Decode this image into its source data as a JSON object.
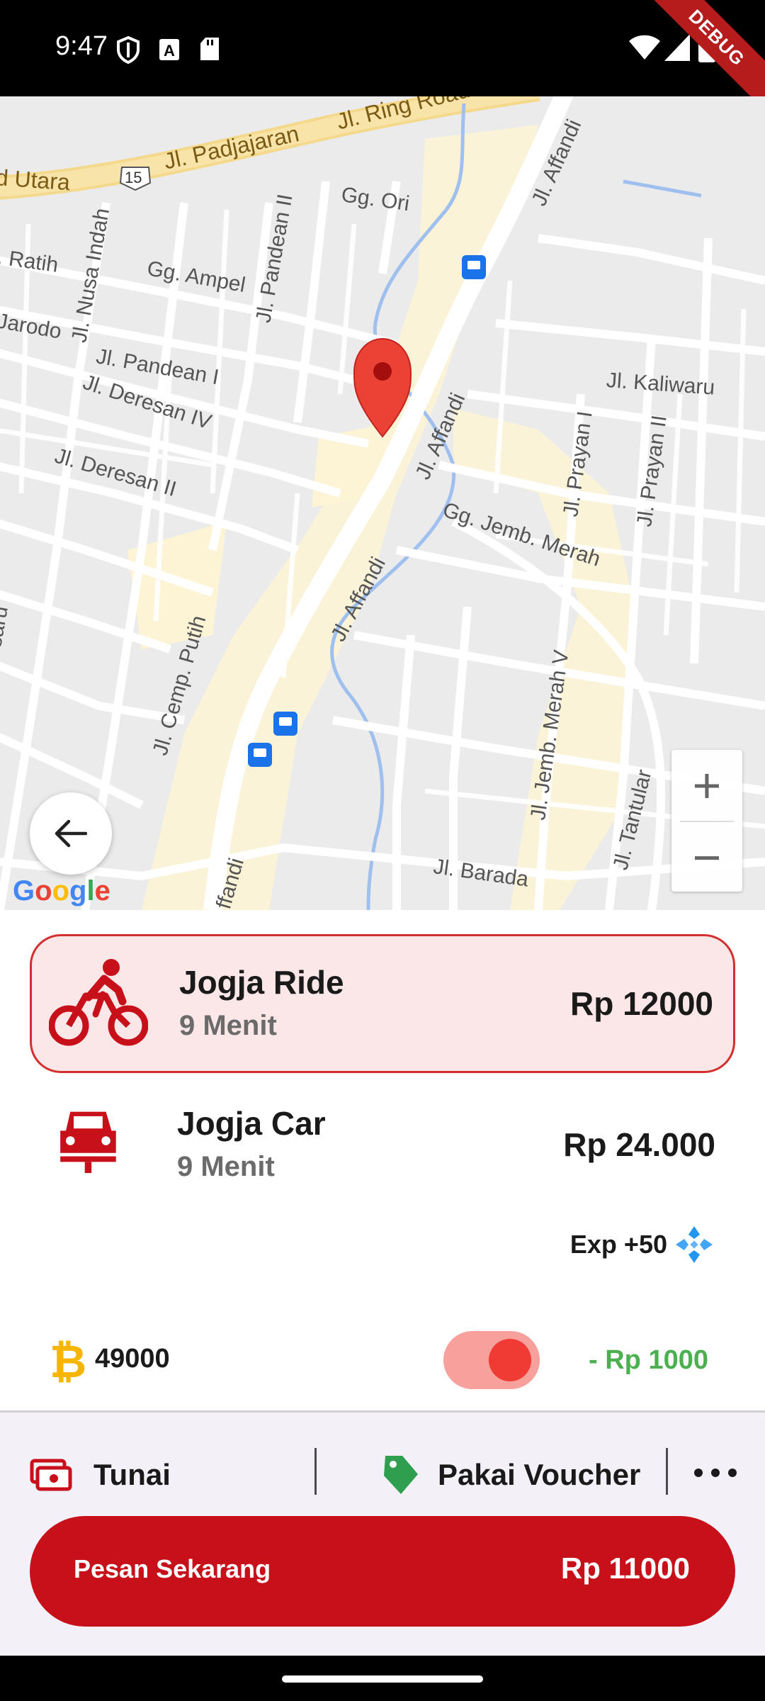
{
  "status_bar": {
    "time": "9:47",
    "debug_banner": "DEBUG",
    "icons": [
      "shield-icon",
      "a-icon",
      "sd-card-icon",
      "wifi-icon",
      "signal-icon",
      "battery-icon"
    ]
  },
  "map": {
    "provider_logo": "Google",
    "zoom_in": "+",
    "zoom_out": "−",
    "street_labels": {
      "ring_road": "Jl. Ring Road",
      "padjajaran": "Jl. Padjajaran",
      "utara": "d Utara",
      "route_shield": "15",
      "gg_ori": "Gg. Ori",
      "affandi_top": "Jl. Affandi",
      "ratih": ". Ratih",
      "nusa_indah": "Jl. Nusa Indah",
      "gg_ampel": "Gg. Ampel",
      "pandean_ii": "Jl. Pandean II",
      "jarodo": "Jarodo",
      "pandean_i": "Jl. Pandean I",
      "deresan_iv": "Jl. Deresan IV",
      "deresan_ii": "Jl. Deresan II",
      "affandi_mid": "Jl. Affandi",
      "kaliwaru": "Jl. Kaliwaru",
      "prayan_i": "Jl. Prayan I",
      "prayan_ii": "Jl. Prayan II",
      "jemb_merah": "Gg. Jemb. Merah",
      "affandi_low": "Jl. Affandi",
      "cemp_putih": "Jl. Cemp. Putih",
      "jemb_merah_v": "Jl. Jemb. Merah V",
      "tantular": "Jl. Tantular",
      "barada": "Jl. Barada",
      "affandi_bottom": "Affandi",
      "left_edge": "saru"
    }
  },
  "services": [
    {
      "name": "Jogja Ride",
      "eta": "9 Menit",
      "price": "Rp 12000",
      "icon": "motorbike-icon",
      "selected": true
    },
    {
      "name": "Jogja Car",
      "eta": "9 Menit",
      "price": "Rp 24.000",
      "icon": "car-icon",
      "selected": false
    }
  ],
  "exp": {
    "label": "Exp",
    "value": "+50",
    "icon": "exp-diamond-icon"
  },
  "points": {
    "value": "49000",
    "icon": "bitcoin-icon",
    "toggle_on": true,
    "discount": "- Rp 1000"
  },
  "payment": {
    "method_label": "Tunai",
    "method_icon": "cash-icon",
    "voucher_label": "Pakai Voucher",
    "voucher_icon": "tag-icon"
  },
  "order": {
    "label": "Pesan Sekarang",
    "price": "Rp 11000"
  },
  "colors": {
    "brand_red": "#c8101a",
    "selected_bg": "#fbe6e8",
    "discount_green": "#4caf50",
    "coin_yellow": "#f5b500",
    "voucher_green": "#2e9e4f"
  }
}
